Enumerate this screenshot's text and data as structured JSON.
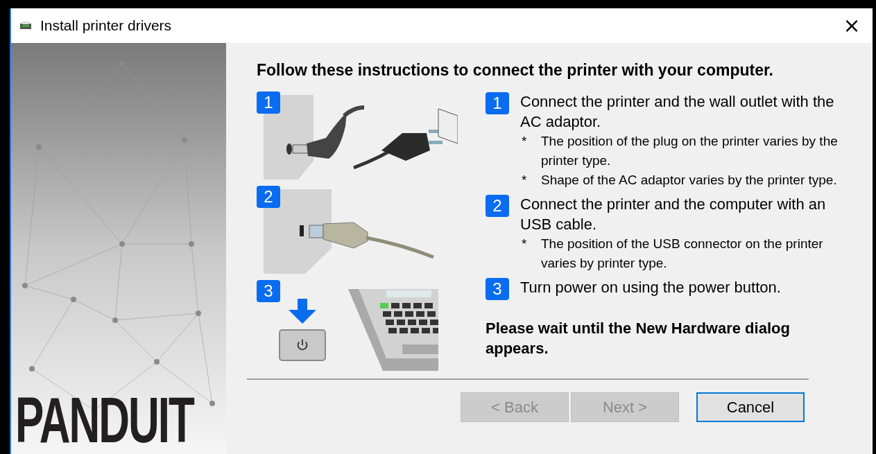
{
  "window": {
    "title": "Install printer drivers",
    "close": "×"
  },
  "sidebar": {
    "logo": "PANDUIT"
  },
  "heading": "Follow these instructions to connect the printer with your computer.",
  "illustrations": [
    {
      "number": "1",
      "kind": "ac-plug"
    },
    {
      "number": "2",
      "kind": "usb"
    },
    {
      "number": "3",
      "kind": "power"
    }
  ],
  "steps": [
    {
      "number": "1",
      "text": "Connect the printer and the wall outlet with the AC adaptor.",
      "notes": [
        {
          "mark": "*",
          "text": "The position of the plug on the printer varies by the printer type."
        },
        {
          "mark": "*",
          "text": "Shape of the AC adaptor varies by the printer type."
        }
      ]
    },
    {
      "number": "2",
      "text": "Connect the printer and the computer with an USB cable.",
      "notes": [
        {
          "mark": "*",
          "text": "The position of the USB connector on the printer varies by printer type."
        }
      ]
    },
    {
      "number": "3",
      "text": "Turn power on using the power button."
    }
  ],
  "wait_message": "Please wait until the New Hardware dialog appears.",
  "buttons": [
    {
      "label": "< Back",
      "disabled": true,
      "focused": false
    },
    {
      "label": "Next >",
      "disabled": true,
      "focused": false
    },
    {
      "label": "Cancel",
      "disabled": false,
      "focused": true
    }
  ]
}
